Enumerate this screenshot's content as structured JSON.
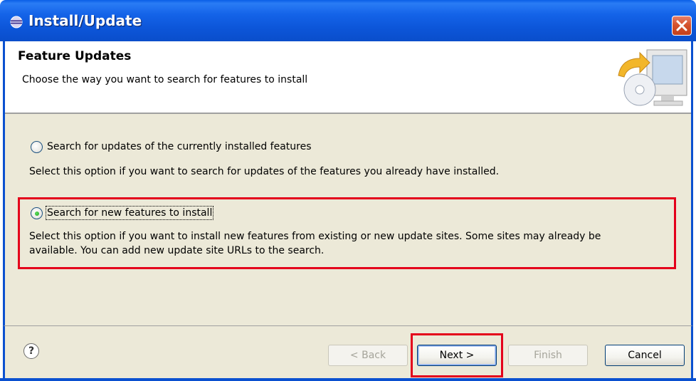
{
  "window": {
    "title": "Install/Update"
  },
  "header": {
    "title": "Feature Updates",
    "description": "Choose the way you want to search for features to install",
    "graphic_icon": "install-monitor-cd-icon"
  },
  "options": [
    {
      "label": "Search for updates of the currently installed features",
      "description": "Select this option if you want to search for updates of the features you already have installed.",
      "selected": false
    },
    {
      "label": "Search for new features to install",
      "description_line1": "Select this option if you want to install new features from existing or new update sites. Some sites may already be",
      "description_line2": "available. You can add new update site URLs to the search.",
      "selected": true
    }
  ],
  "footer": {
    "help_symbol": "?",
    "back_label": "< Back",
    "next_label": "Next >",
    "finish_label": "Finish",
    "cancel_label": "Cancel"
  },
  "colors": {
    "titlebar": "#0a5ee6",
    "highlight": "#e4001b",
    "dialog_bg": "#ece9d8"
  }
}
